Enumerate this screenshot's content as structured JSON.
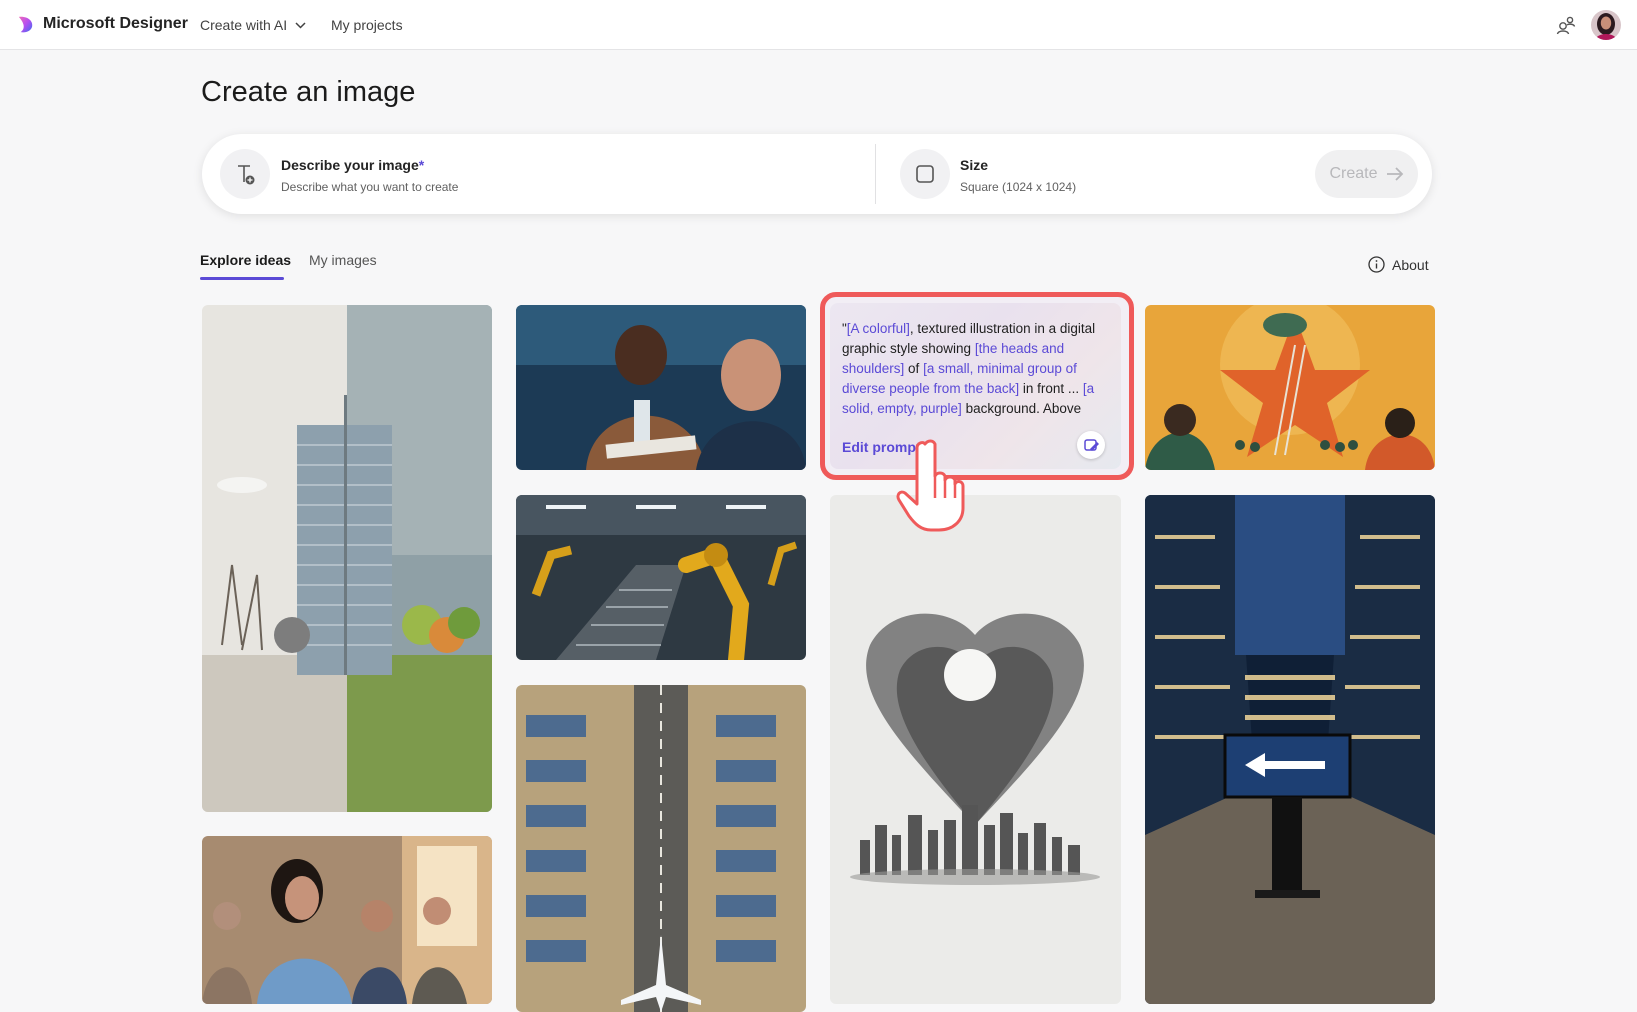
{
  "app": {
    "brand": "Microsoft Designer",
    "nav": {
      "create_with_ai": "Create with AI",
      "my_projects": "My projects"
    }
  },
  "page": {
    "title": "Create an image"
  },
  "prompt_bar": {
    "describe_label": "Describe your image",
    "describe_required_mark": "*",
    "describe_sub": "Describe what you want to create",
    "size_label": "Size",
    "size_value": "Square (1024 x 1024)",
    "create_label": "Create"
  },
  "tabs": {
    "explore": "Explore ideas",
    "my_images": "My images",
    "about": "About"
  },
  "prompt_card": {
    "open_quote": "\"",
    "p1": "[A colorful]",
    "t1": ", textured illustration in a digital graphic style showing ",
    "p2": "[the heads and shoulders]",
    "t2": " of ",
    "p3": "[a small, minimal group of diverse people from the back]",
    "t3": " in front ... ",
    "p4": "[a solid, empty, purple]",
    "t4": " background. Above",
    "edit_prompt": "Edit prompt"
  },
  "colors": {
    "accent": "#5b4ad6",
    "highlight": "#ef5a5a",
    "create_disabled": "#b8b8bb"
  },
  "icons": [
    "designer-logo-icon",
    "chevron-down-icon",
    "share-people-icon",
    "text-add-icon",
    "square-size-icon",
    "arrow-right-icon",
    "info-icon",
    "edit-image-icon",
    "pointer-hand-icon"
  ]
}
